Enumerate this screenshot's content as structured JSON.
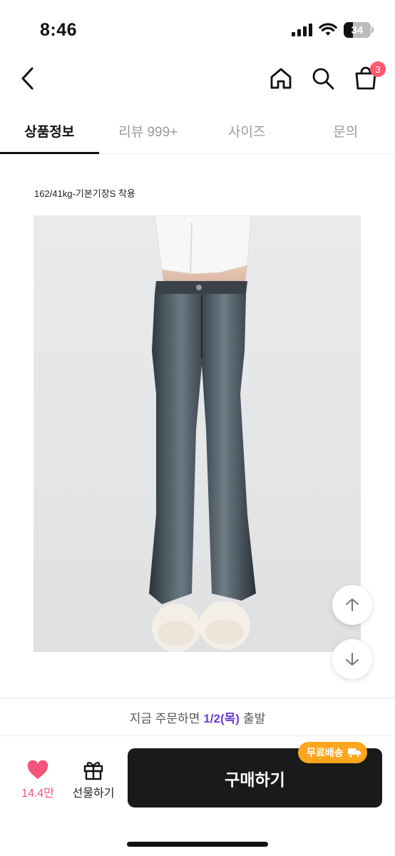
{
  "status": {
    "time": "8:46",
    "battery": "34",
    "battery_level": 0.34
  },
  "header": {
    "cart_count": "3"
  },
  "tabs": [
    {
      "label": "상품정보",
      "active": true
    },
    {
      "label": "리뷰 999+",
      "active": false
    },
    {
      "label": "사이즈",
      "active": false
    },
    {
      "label": "문의",
      "active": false
    }
  ],
  "content": {
    "caption": "162/41kg-기본기장S 착용"
  },
  "shipping": {
    "prefix": "지금 주문하면",
    "date": "1/2(목)",
    "suffix": "출발"
  },
  "bottom": {
    "like_count": "14.4만",
    "gift_label": "선물하기",
    "buy_label": "구매하기",
    "free_ship_label": "무료배송"
  },
  "colors": {
    "accent_purple": "#6c3fd4",
    "like_pink": "#f2547a",
    "badge_orange": "#ffa51e",
    "cart_badge": "#ff5a6e",
    "buy_button": "#1a1a1a"
  },
  "icons": [
    "back-arrow-icon",
    "home-icon",
    "search-icon",
    "shopping-bag-icon",
    "arrow-up-icon",
    "arrow-down-icon",
    "heart-icon",
    "gift-icon",
    "truck-icon"
  ]
}
